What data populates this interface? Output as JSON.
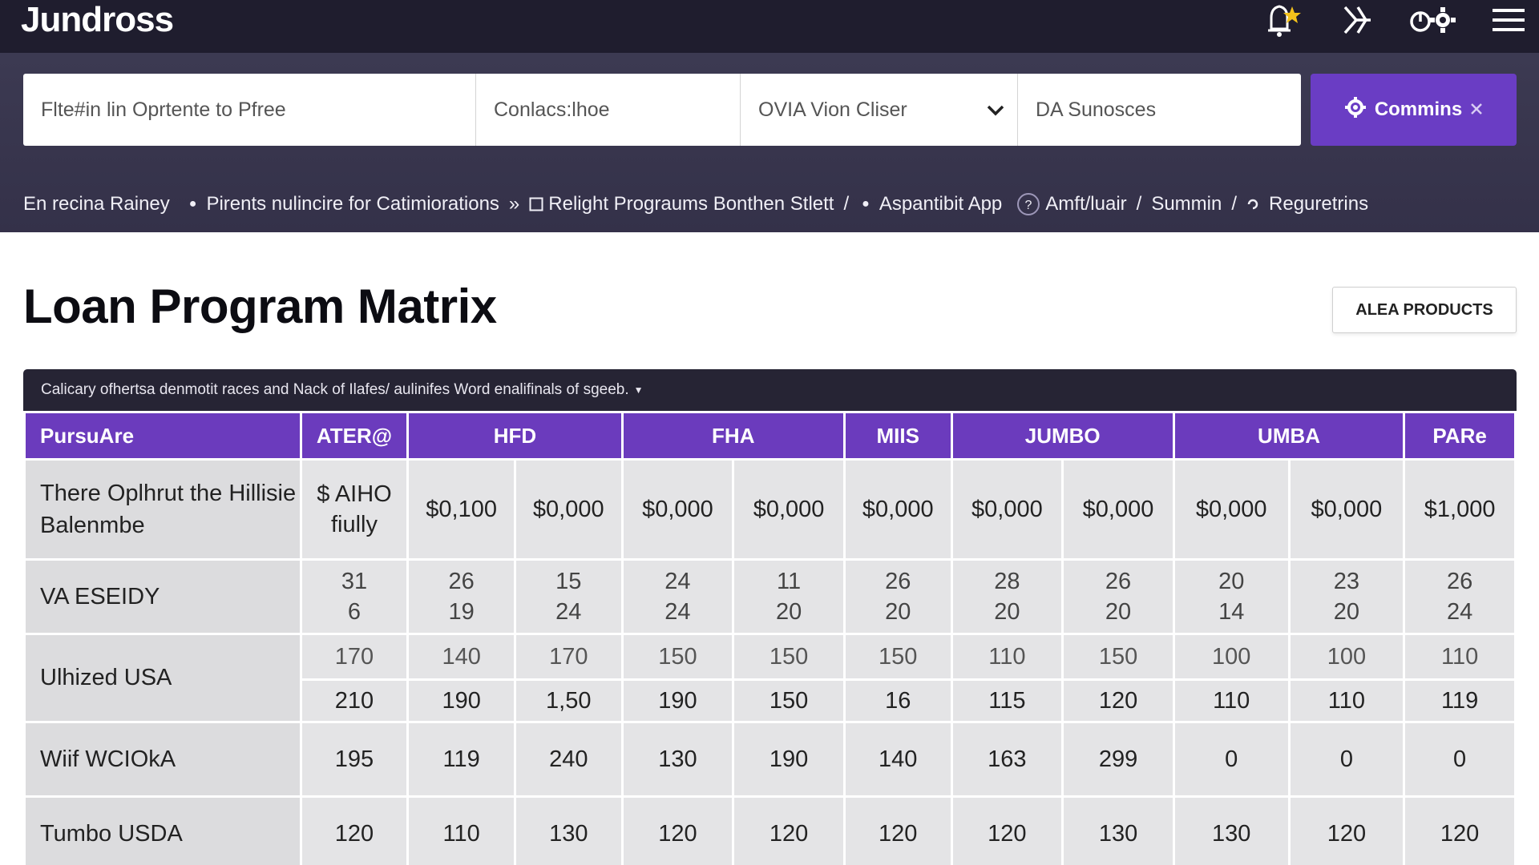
{
  "app": {
    "name": "Jundross"
  },
  "topbar_icons": [
    "bell-star-icon",
    "share-network-icon",
    "power-settings-icon",
    "hamburger-menu-icon"
  ],
  "filters": {
    "field1": "Flte#in lin Oprtente to Pfree",
    "field2": "Conlacs:lhoe",
    "field3": "OVIA Vion Cliser",
    "field4": "DA Sunosces"
  },
  "cta": {
    "label": "Commins"
  },
  "breadcrumbs": [
    "En recina Rainey",
    "Pirents nulincire for Catimiorations",
    "Relight Prograums Bonthen Stlett",
    "Aspantibit App",
    "Amft/luair",
    "Summin",
    "Reguretrins"
  ],
  "page": {
    "title": "Loan Program Matrix",
    "action_label": "ALEA PRODUCTS"
  },
  "note": "Calicary ofhertsa denmotit races and Nack of Ilafes/ aulinifes Word enalifinals of sgeeb.",
  "table": {
    "headers": [
      "PursuAre",
      "ATER@",
      "HFD",
      "FHA",
      "MIIS",
      "JUMBO",
      "UMBA",
      "PARe"
    ],
    "rows": [
      {
        "label": "There Oplhrut the Hillisie Balenmbe",
        "values": [
          "$ AIHO fiully",
          "$0,100",
          "$0,000",
          "$0,000",
          "$0,000",
          "$0,000",
          "$0,000",
          "$0,000",
          "$0,000",
          "$0,000",
          "$1,000"
        ]
      },
      {
        "label": "VA ESEIDY",
        "top": [
          "31",
          "26",
          "15",
          "24",
          "11",
          "26",
          "28",
          "26",
          "20",
          "23",
          "26"
        ],
        "bottom": [
          "6",
          "19",
          "24",
          "24",
          "20",
          "20",
          "20",
          "20",
          "14",
          "20",
          "24"
        ]
      },
      {
        "label": "Ulhized USA",
        "top": [
          "170",
          "140",
          "170",
          "150",
          "150",
          "150",
          "110",
          "150",
          "100",
          "100",
          "110"
        ],
        "bottom": [
          "210",
          "190",
          "1,50",
          "190",
          "150",
          "16",
          "115",
          "120",
          "110",
          "110",
          "119"
        ]
      },
      {
        "label": "Wiif WCIOkA",
        "values": [
          "195",
          "119",
          "240",
          "130",
          "190",
          "140",
          "163",
          "299",
          "0",
          "0",
          "0"
        ]
      },
      {
        "label": "Tumbo USDA",
        "values": [
          "120",
          "110",
          "130",
          "120",
          "120",
          "120",
          "120",
          "130",
          "130",
          "120",
          "120"
        ]
      }
    ]
  }
}
